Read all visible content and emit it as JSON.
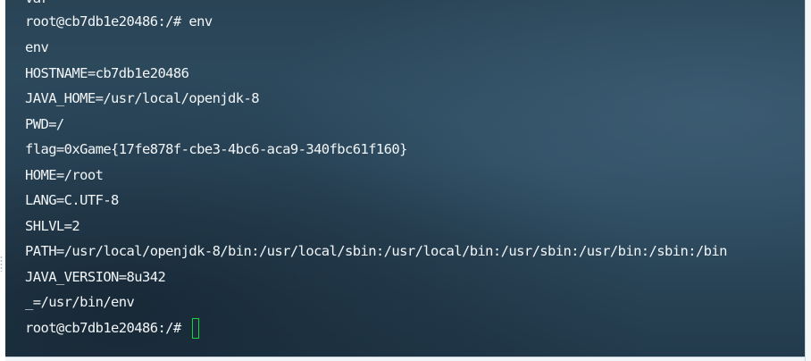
{
  "terminal": {
    "lines": [
      "var",
      "root@cb7db1e20486:/# env",
      "env",
      "HOSTNAME=cb7db1e20486",
      "JAVA_HOME=/usr/local/openjdk-8",
      "PWD=/",
      "flag=0xGame{17fe878f-cbe3-4bc6-aca9-340fbc61f160}",
      "HOME=/root",
      "LANG=C.UTF-8",
      "SHLVL=2",
      "PATH=/usr/local/openjdk-8/bin:/usr/local/sbin:/usr/local/bin:/usr/sbin:/usr/bin:/sbin:/bin",
      "JAVA_VERSION=8u342",
      "_=/usr/bin/env",
      "root@cb7db1e20486:/# "
    ]
  },
  "colors": {
    "background": "#2f4d62",
    "text": "#f1f5f7",
    "cursor": "#19d33c"
  }
}
